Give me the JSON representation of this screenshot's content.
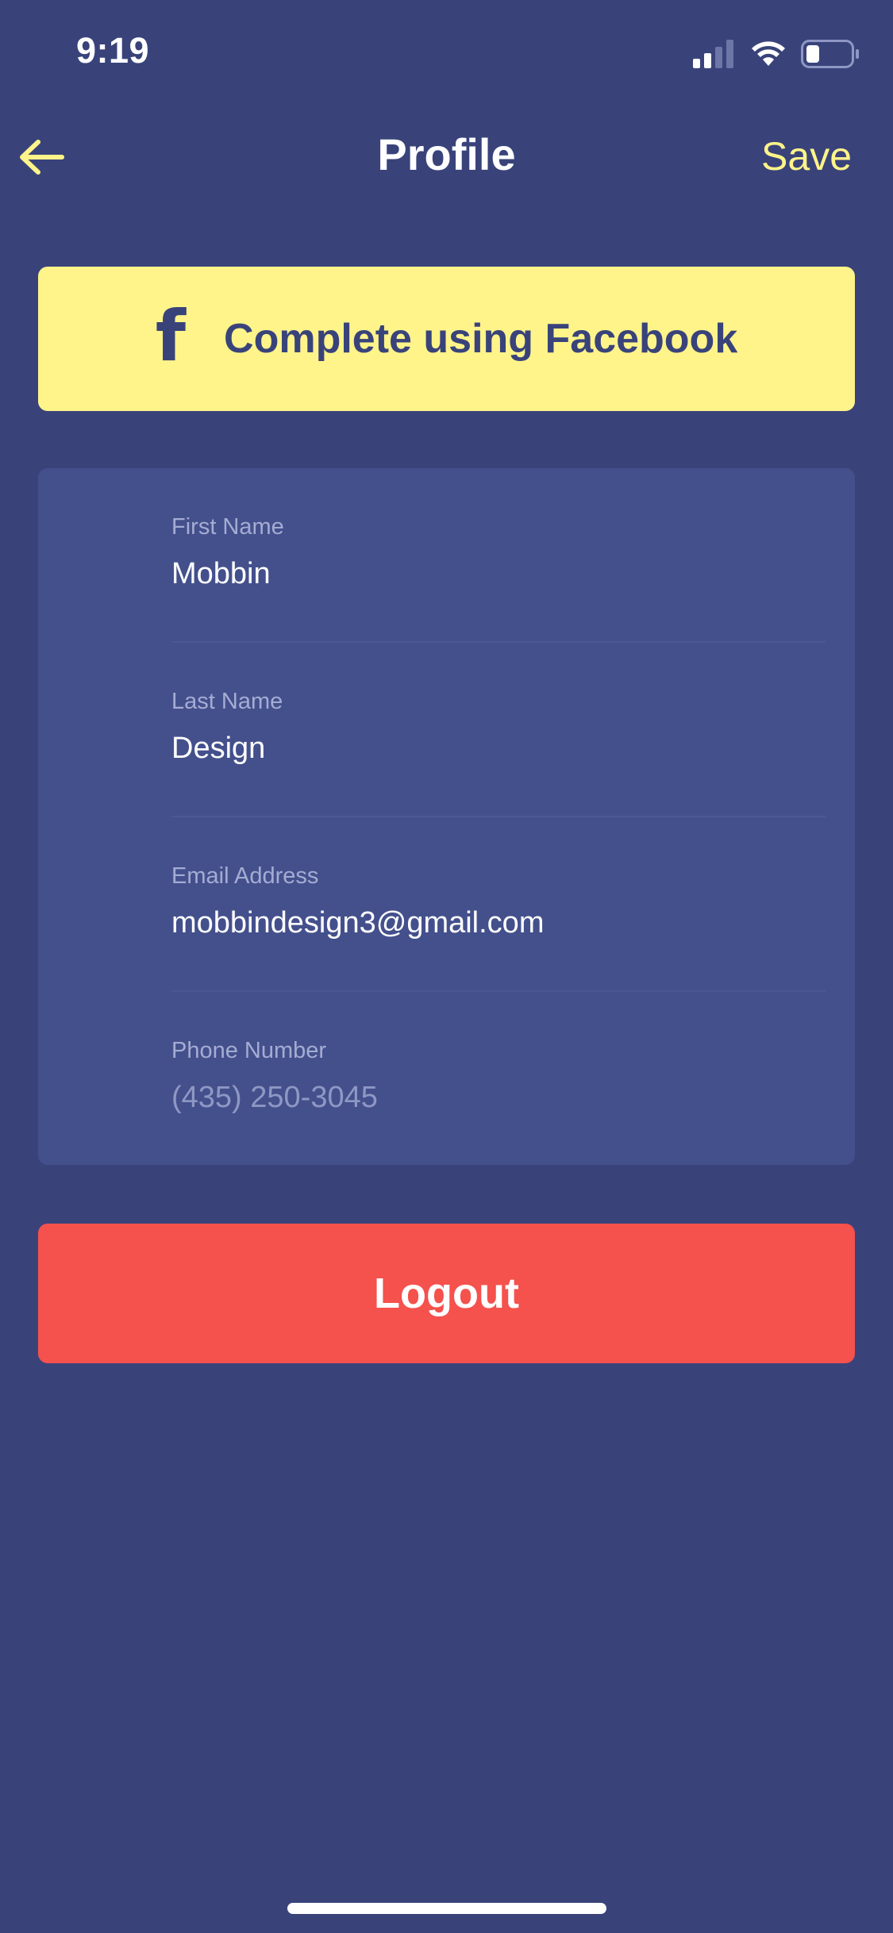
{
  "status_bar": {
    "time": "9:19",
    "icons": [
      "signal-icon",
      "wifi-icon",
      "battery-icon"
    ]
  },
  "nav": {
    "back_icon": "arrow-left-icon",
    "title": "Profile",
    "save_label": "Save"
  },
  "facebook": {
    "icon": "facebook-icon",
    "icon_glyph": "f",
    "label": "Complete using Facebook"
  },
  "form": {
    "fields": [
      {
        "label": "First Name",
        "value": "Mobbin",
        "placeholder": ""
      },
      {
        "label": "Last Name",
        "value": "Design",
        "placeholder": ""
      },
      {
        "label": "Email Address",
        "value": "mobbindesign3@gmail.com",
        "placeholder": ""
      },
      {
        "label": "Phone Number",
        "value": "",
        "placeholder": "(435) 250-3045"
      }
    ]
  },
  "logout_label": "Logout",
  "colors": {
    "background": "#39437a",
    "card": "#44508c",
    "accent_yellow": "#fff48a",
    "logout_red": "#f5514d",
    "label_muted": "#a5acd3"
  }
}
